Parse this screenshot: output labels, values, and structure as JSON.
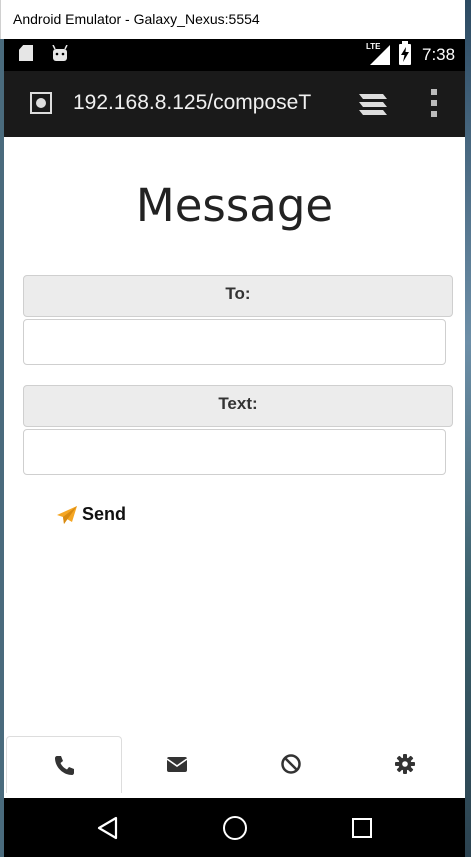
{
  "window": {
    "title": "Android Emulator - Galaxy_Nexus:5554"
  },
  "statusbar": {
    "network": "LTE",
    "time": "7:38"
  },
  "browser": {
    "url": "192.168.8.125/composeT"
  },
  "page": {
    "title": "Message",
    "to_label": "To:",
    "to_value": "",
    "text_label": "Text:",
    "text_value": "",
    "send_label": "Send"
  },
  "bottom_nav": {
    "items": [
      "phone-icon",
      "envelope-icon",
      "ban-icon",
      "gear-icon"
    ],
    "active": 0
  },
  "colors": {
    "send_icon": "#f5a623",
    "toolbar": "#1a1a1a",
    "active_tab_border": "#dddddd"
  }
}
